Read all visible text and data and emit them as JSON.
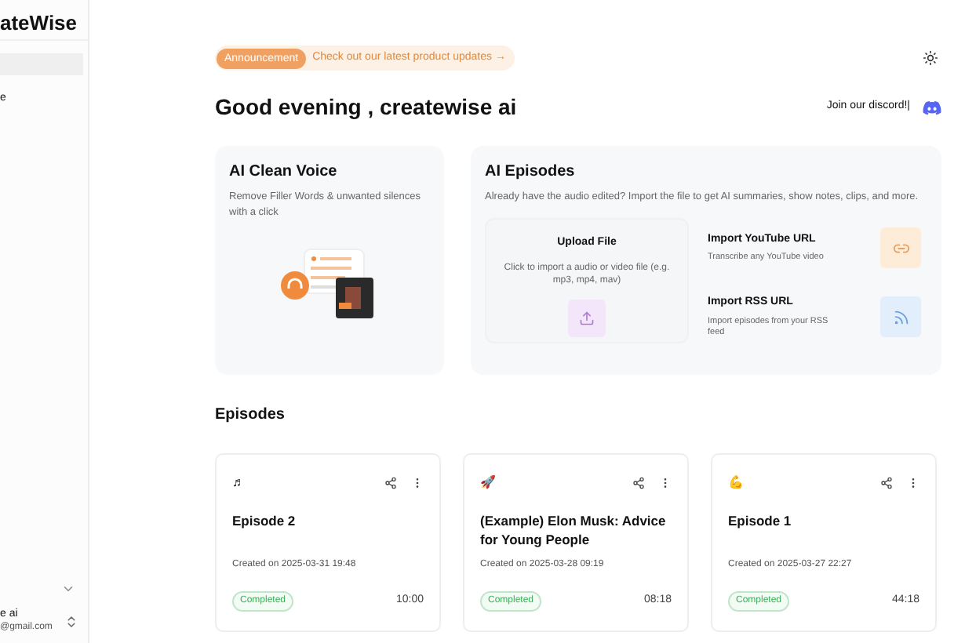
{
  "sidebar": {
    "logo": "ateWise",
    "items": [
      {
        "selected": true
      },
      {
        "label": "e",
        "selected": false
      }
    ],
    "user": {
      "name": "e ai",
      "email": "@gmail.com"
    }
  },
  "announcement": {
    "badge": "Announcement",
    "text": "Check out our latest product updates →"
  },
  "greeting": "Good evening , createwise ai",
  "discord": "Join our discord!|",
  "clean_voice": {
    "title": "AI Clean Voice",
    "description": "Remove Filler Words & unwanted silences with a click"
  },
  "ai_episodes": {
    "title": "AI Episodes",
    "description": "Already have the audio edited? Import the file to get AI summaries, show notes, clips, and more.",
    "upload": {
      "title": "Upload File",
      "description": "Click to import a audio or video file (e.g. mp3, mp4, mav)"
    },
    "imports": [
      {
        "kind": "youtube",
        "title": "Import YouTube URL",
        "description": "Transcribe any YouTube video"
      },
      {
        "kind": "rss",
        "title": "Import RSS URL",
        "description": "Import episodes from your RSS feed"
      }
    ]
  },
  "episodes": {
    "title": "Episodes",
    "items": [
      {
        "emoji": "♬",
        "title": "Episode 2",
        "created": "Created on 2025-03-31 19:48",
        "status": "Completed",
        "duration": "10:00"
      },
      {
        "emoji": "🚀",
        "title": "(Example) Elon Musk: Advice for Young People",
        "created": "Created on 2025-03-28 09:19",
        "status": "Completed",
        "duration": "08:18"
      },
      {
        "emoji": "💪",
        "title": "Episode 1",
        "created": "Created on 2025-03-27 22:27",
        "status": "Completed",
        "duration": "44:18"
      }
    ]
  }
}
